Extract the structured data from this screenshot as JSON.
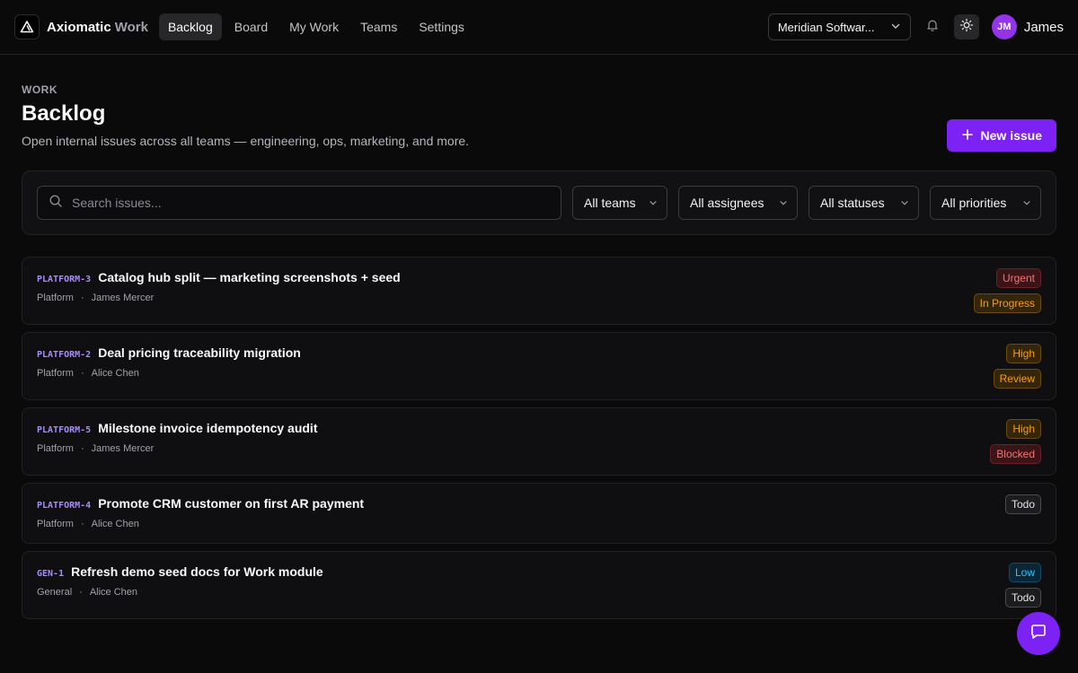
{
  "brand": {
    "name": "Axiomatic",
    "sub": "Work",
    "logo_icon": "triangle-logo-icon"
  },
  "nav": [
    {
      "label": "Backlog",
      "active": true
    },
    {
      "label": "Board",
      "active": false
    },
    {
      "label": "My Work",
      "active": false
    },
    {
      "label": "Teams",
      "active": false
    },
    {
      "label": "Settings",
      "active": false
    }
  ],
  "header": {
    "org": "Meridian Softwar...",
    "user_initials": "JM",
    "user_name": "James"
  },
  "page": {
    "eyebrow": "WORK",
    "title": "Backlog",
    "subtitle": "Open internal issues across all teams — engineering, ops, marketing, and more.",
    "new_issue_label": "New issue"
  },
  "filters": {
    "search_placeholder": "Search issues...",
    "teams": "All teams",
    "assignees": "All assignees",
    "statuses": "All statuses",
    "priorities": "All priorities"
  },
  "issues": [
    {
      "key": "PLATFORM-3",
      "title": "Catalog hub split — marketing screenshots + seed",
      "team": "Platform",
      "sep": "·",
      "assignee": "James Mercer",
      "priority": "Urgent",
      "status": "In Progress"
    },
    {
      "key": "PLATFORM-2",
      "title": "Deal pricing traceability migration",
      "team": "Platform",
      "sep": "·",
      "assignee": "Alice Chen",
      "priority": "High",
      "status": "Review"
    },
    {
      "key": "PLATFORM-5",
      "title": "Milestone invoice idempotency audit",
      "team": "Platform",
      "sep": "·",
      "assignee": "James Mercer",
      "priority": "High",
      "status": "Blocked"
    },
    {
      "key": "PLATFORM-4",
      "title": "Promote CRM customer on first AR payment",
      "team": "Platform",
      "sep": "·",
      "assignee": "Alice Chen",
      "status": "Todo"
    },
    {
      "key": "GEN-1",
      "title": "Refresh demo seed docs for Work module",
      "team": "General",
      "sep": "·",
      "assignee": "Alice Chen",
      "priority": "Low",
      "status": "Todo"
    }
  ],
  "colors": {
    "accent": "#7c22f5",
    "background": "#0a0a0b",
    "key": "#a78bfa"
  }
}
